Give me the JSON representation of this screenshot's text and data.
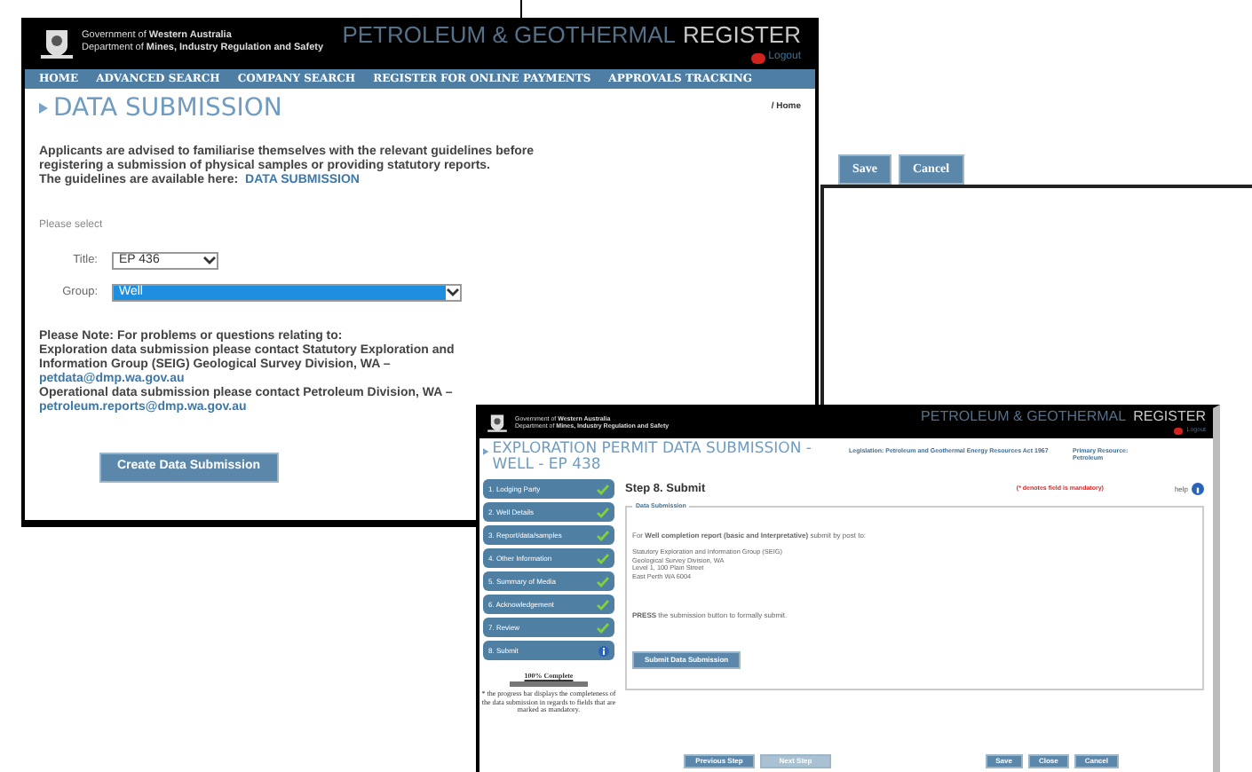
{
  "background_window": {
    "buttons": [
      "Save",
      "Cancel"
    ]
  },
  "data_submission_window": {
    "header": {
      "government": "Government of **Western Australia**",
      "department": "Department of **Mines, Industry Regulation and Safety**",
      "register_title": "PETROLEUM & GEOTHERMAL",
      "register_word": "REGISTER",
      "logout": "Logout"
    },
    "nav": [
      "HOME",
      "ADVANCED SEARCH",
      "COMPANY SEARCH",
      "REGISTER FOR ONLINE PAYMENTS",
      "APPROVALS TRACKING"
    ],
    "page_title": "DATA SUBMISSION",
    "breadcrumb": "/ Home",
    "intro": "Applicants are advised to familiarise themselves with the relevant guidelines before registering a submission of physical samples or providing statutory reports.",
    "guidelines_text": "The guidelines are available here:",
    "guidelines_link": "DATA SUBMISSION",
    "select_prompt": "Please select",
    "fields": [
      {
        "label": "Title:",
        "value": "EP 436",
        "highlighted": false
      },
      {
        "label": "Group:",
        "value": "Well",
        "highlighted": true
      }
    ],
    "note": [
      {
        "kind": "text",
        "text": "Please Note: For problems or questions relating to:"
      },
      {
        "kind": "text",
        "text": "Exploration data submission please contact Statutory Exploration and Information Group (SEIG) Geological Survey Division, WA –"
      },
      {
        "kind": "link",
        "text": "petdata@dmp.wa.gov.au"
      },
      {
        "kind": "text",
        "text": "Operational data submission please contact Petroleum Division, WA –"
      },
      {
        "kind": "link",
        "text": "petroleum.reports@dmp.wa.gov.au"
      }
    ],
    "create_button": "Create Data Submission"
  },
  "permit_window": {
    "header": {
      "government": "Government of **Western Australia**",
      "department": "Department of **Mines, Industry Regulation and Safety**",
      "register_title": "PETROLEUM & GEOTHERMAL",
      "register_word": "REGISTER",
      "logout": "Logout"
    },
    "page_title": "EXPLORATION PERMIT DATA SUBMISSION - WELL - EP 438",
    "legislation": "Legislation: Petroleum and Geothermal Energy Resources Act 1967",
    "primary_resource": "Primary Resource: Petroleum",
    "step_title": "Step 8.  Submit",
    "mandatory_note": "(* denotes field is mandatory)",
    "help": "help",
    "steps": [
      {
        "label": "1. Lodging Party",
        "completed": true
      },
      {
        "label": "2. Well Details",
        "completed": true
      },
      {
        "label": "3. Report/data/samples",
        "completed": true
      },
      {
        "label": "4. Other Information",
        "completed": true
      },
      {
        "label": "5. Summary of Media",
        "completed": true
      },
      {
        "label": "6. Acknowledgement",
        "completed": true
      },
      {
        "label": "7. Review",
        "completed": true
      },
      {
        "label": "8. Submit",
        "completed": false
      }
    ],
    "progress": {
      "label": "100% Complete",
      "level": 1,
      "note": "* the progress bar displays the completeness of the data submission in regards to fields that are marked as mandatory."
    },
    "panel_legend": "Data Submission",
    "instruction": "For **Well completion report (basic and Interpretative)** submit by post to:",
    "address": [
      "Statutory Exploration and Information Group (SEIG)",
      "Geological Survey Division, WA",
      "Level 1, 100 Plain Street",
      "East Perth WA 6004"
    ],
    "press_text": "**PRESS** the submission button to formally submit.",
    "submit_button": "Submit Data Submission",
    "nav_buttons": [
      {
        "label": "Previous Step",
        "disabled": false
      },
      {
        "label": "Next Step",
        "disabled": true
      }
    ],
    "action_buttons": [
      "Save",
      "Close",
      "Cancel"
    ]
  }
}
